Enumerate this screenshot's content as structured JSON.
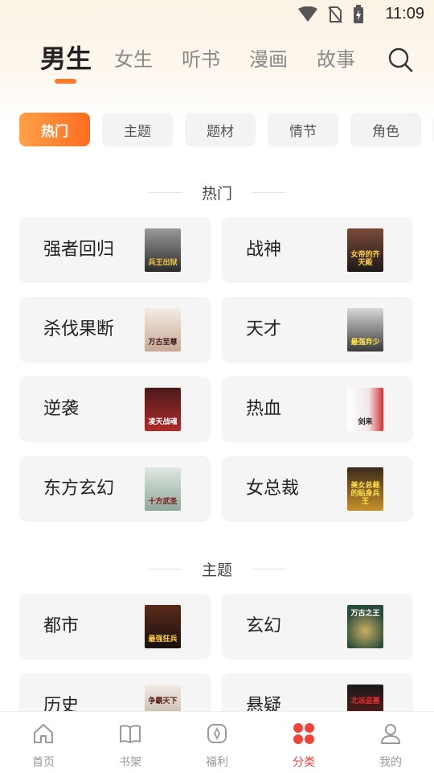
{
  "status_bar": {
    "time": "11:09"
  },
  "top_tabs": [
    {
      "label": "男生",
      "active": true
    },
    {
      "label": "女生"
    },
    {
      "label": "听书"
    },
    {
      "label": "漫画"
    },
    {
      "label": "故事"
    }
  ],
  "chips": [
    {
      "label": "热门",
      "active": true
    },
    {
      "label": "主题"
    },
    {
      "label": "题材"
    },
    {
      "label": "情节"
    },
    {
      "label": "角色"
    }
  ],
  "sections": {
    "hot": {
      "title": "热门",
      "items": [
        {
          "label": "强者回归",
          "cover_text": "兵王出狱"
        },
        {
          "label": "战神",
          "cover_text": "女帝的齐天殿"
        },
        {
          "label": "杀伐果断",
          "cover_text": "万古至尊"
        },
        {
          "label": "天才",
          "cover_text": "最强弃少"
        },
        {
          "label": "逆袭",
          "cover_text": "凌天战魂"
        },
        {
          "label": "热血",
          "cover_text": "剑来"
        },
        {
          "label": "东方玄幻",
          "cover_text": "十方武圣"
        },
        {
          "label": "女总裁",
          "cover_text": "美女总裁的贴身兵王"
        }
      ]
    },
    "theme": {
      "title": "主题",
      "items": [
        {
          "label": "都市",
          "cover_text": "最强狂兵"
        },
        {
          "label": "玄幻",
          "cover_text": "万古之王"
        },
        {
          "label": "历史",
          "cover_text": "争霸天下"
        },
        {
          "label": "悬疑",
          "cover_text": "北派盗墓"
        }
      ]
    }
  },
  "bottom_nav": [
    {
      "label": "首页"
    },
    {
      "label": "书架"
    },
    {
      "label": "福利"
    },
    {
      "label": "分类",
      "active": true
    },
    {
      "label": "我的"
    }
  ],
  "colors": {
    "accent": "#ff6d1f",
    "nav_active": "#f2433a"
  },
  "icons": [
    "signal-icon",
    "no-sim-icon",
    "battery-charging-icon",
    "search-icon",
    "home-icon",
    "bookshelf-icon",
    "welfare-icon",
    "category-icon",
    "profile-icon"
  ]
}
